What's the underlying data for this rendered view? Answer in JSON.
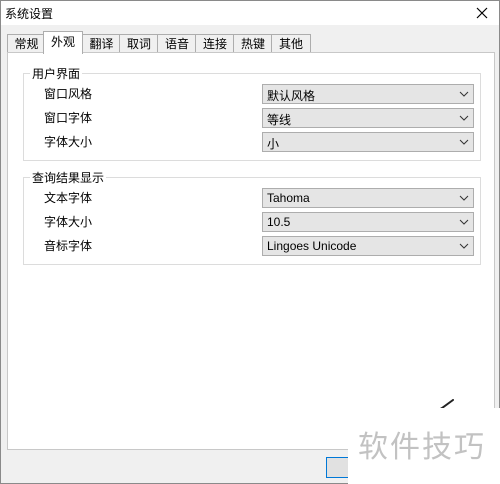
{
  "window": {
    "title": "系统设置"
  },
  "tabs": [
    {
      "label": "常规"
    },
    {
      "label": "外观"
    },
    {
      "label": "翻译"
    },
    {
      "label": "取词"
    },
    {
      "label": "语音"
    },
    {
      "label": "连接"
    },
    {
      "label": "热键"
    },
    {
      "label": "其他"
    }
  ],
  "active_tab": "外观",
  "ui_group": {
    "title": "用户界面",
    "rows": [
      {
        "label": "窗口风格",
        "value": "默认风格"
      },
      {
        "label": "窗口字体",
        "value": "等线"
      },
      {
        "label": "字体大小",
        "value": "小"
      }
    ]
  },
  "result_group": {
    "title": "查询结果显示",
    "rows": [
      {
        "label": "文本字体",
        "value": "Tahoma"
      },
      {
        "label": "字体大小",
        "value": "10.5"
      },
      {
        "label": "音标字体",
        "value": "Lingoes Unicode"
      }
    ]
  },
  "watermark": {
    "text": "软件技巧"
  },
  "colors": {
    "accent_border": "#0078d7",
    "panel": "#ffffff",
    "window_bg": "#f0f0f0"
  },
  "icons": {
    "close": "close-icon",
    "dropdown": "chevron-down-icon",
    "brush": "brush-icon"
  }
}
